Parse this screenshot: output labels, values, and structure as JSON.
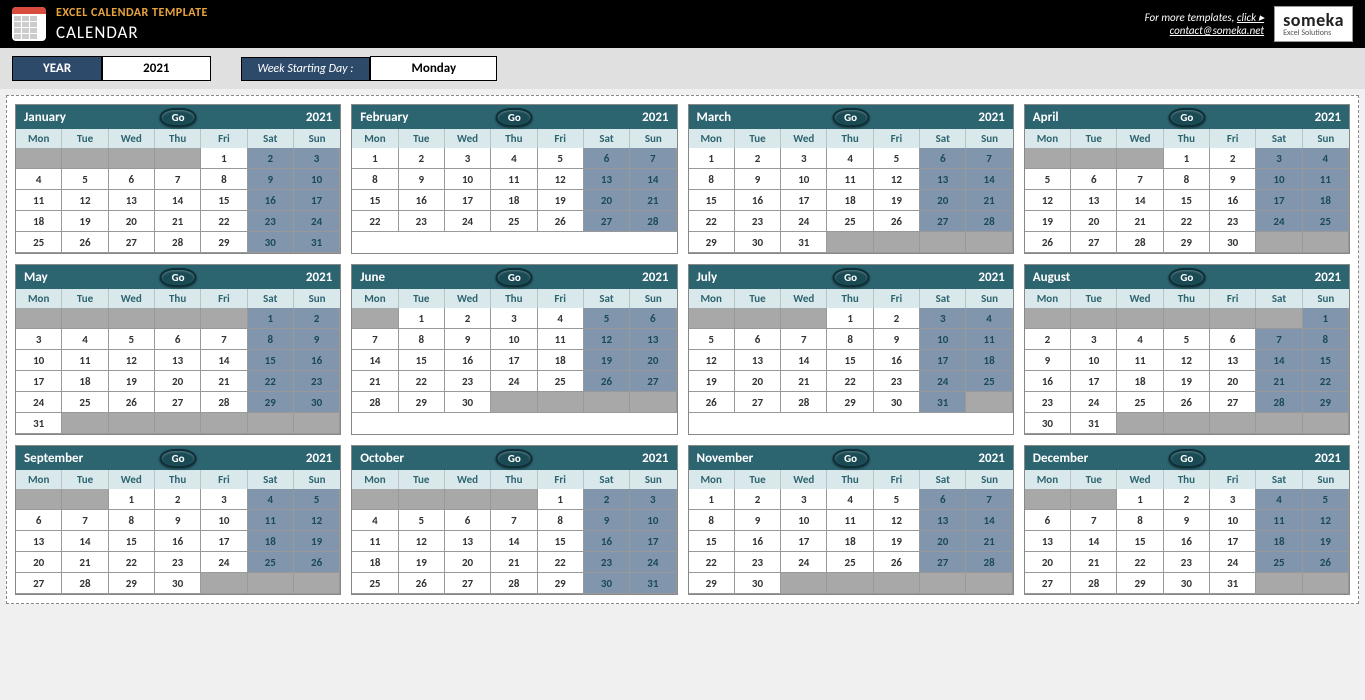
{
  "header": {
    "title_small": "EXCEL CALENDAR TEMPLATE",
    "title_big": "CALENDAR",
    "more_text": "For more templates, ",
    "more_link": "click ▸",
    "contact": "contact@someka.net",
    "logo_main": "someka",
    "logo_sub": "Excel Solutions"
  },
  "controls": {
    "year_label": "YEAR",
    "year_value": "2021",
    "week_label": "Week Starting Day :",
    "week_value": "Monday"
  },
  "dow": [
    "Mon",
    "Tue",
    "Wed",
    "Thu",
    "Fri",
    "Sat",
    "Sun"
  ],
  "go_label": "Go",
  "year": "2021",
  "months": [
    {
      "name": "January",
      "start": 4,
      "end": 31
    },
    {
      "name": "February",
      "start": 0,
      "end": 28
    },
    {
      "name": "March",
      "start": 0,
      "end": 31
    },
    {
      "name": "April",
      "start": 3,
      "end": 30
    },
    {
      "name": "May",
      "start": 5,
      "end": 31
    },
    {
      "name": "June",
      "start": 1,
      "end": 30
    },
    {
      "name": "July",
      "start": 3,
      "end": 31
    },
    {
      "name": "August",
      "start": 6,
      "end": 31
    },
    {
      "name": "September",
      "start": 2,
      "end": 30
    },
    {
      "name": "October",
      "start": 4,
      "end": 31
    },
    {
      "name": "November",
      "start": 0,
      "end": 30
    },
    {
      "name": "December",
      "start": 2,
      "end": 31
    }
  ]
}
